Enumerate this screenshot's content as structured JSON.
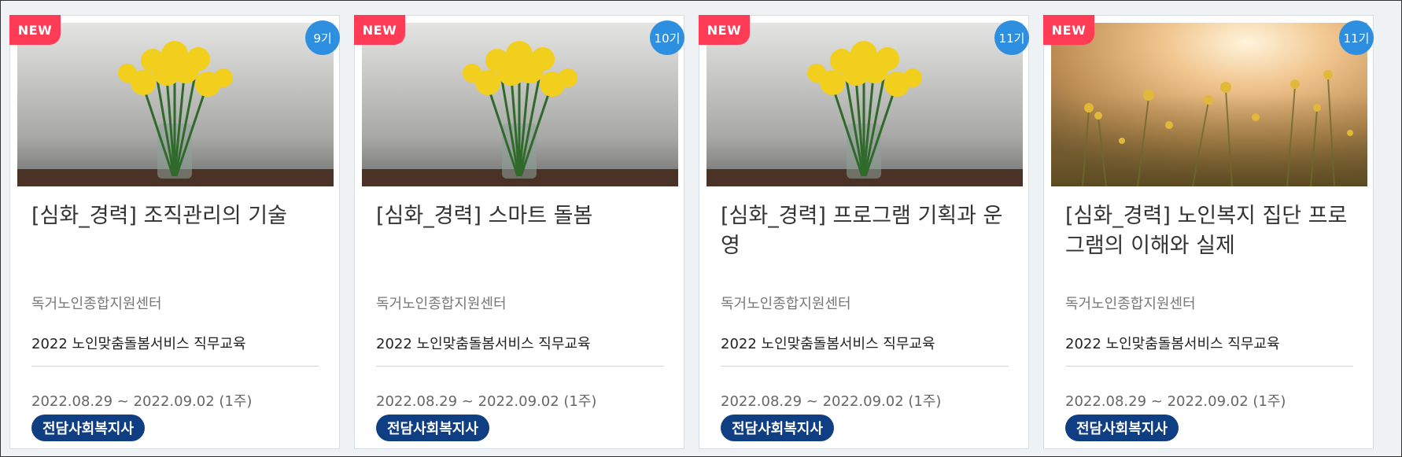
{
  "cards": [
    {
      "new_label": "NEW",
      "generation": "9기",
      "image": "daffodil-vase",
      "title": "[심화_경력] 조직관리의 기술",
      "org": "독거노인종합지원센터",
      "program": "2022 노인맞춤돌봄서비스 직무교육",
      "period": "2022.08.29 ~ 2022.09.02 (1주)",
      "tag": "전담사회복지사"
    },
    {
      "new_label": "NEW",
      "generation": "10기",
      "image": "daffodil-vase",
      "title": "[심화_경력] 스마트 돌봄",
      "org": "독거노인종합지원센터",
      "program": "2022 노인맞춤돌봄서비스 직무교육",
      "period": "2022.08.29 ~ 2022.09.02 (1주)",
      "tag": "전담사회복지사"
    },
    {
      "new_label": "NEW",
      "generation": "11기",
      "image": "daffodil-vase",
      "title": "[심화_경력] 프로그램 기획과 운영",
      "org": "독거노인종합지원센터",
      "program": "2022 노인맞춤돌봄서비스 직무교육",
      "period": "2022.08.29 ~ 2022.09.02 (1주)",
      "tag": "전담사회복지사"
    },
    {
      "new_label": "NEW",
      "generation": "11기",
      "image": "sunset-wildflowers",
      "title": "[심화_경력] 노인복지 집단 프로그램의 이해와 실제",
      "org": "독거노인종합지원센터",
      "program": "2022 노인맞춤돌봄서비스 직무교육",
      "period": "2022.08.29 ~ 2022.09.02 (1주)",
      "tag": "전담사회복지사"
    }
  ],
  "colors": {
    "new_badge": "#ff3b55",
    "generation_badge": "#2e8fe0",
    "tag": "#0f3e82"
  }
}
